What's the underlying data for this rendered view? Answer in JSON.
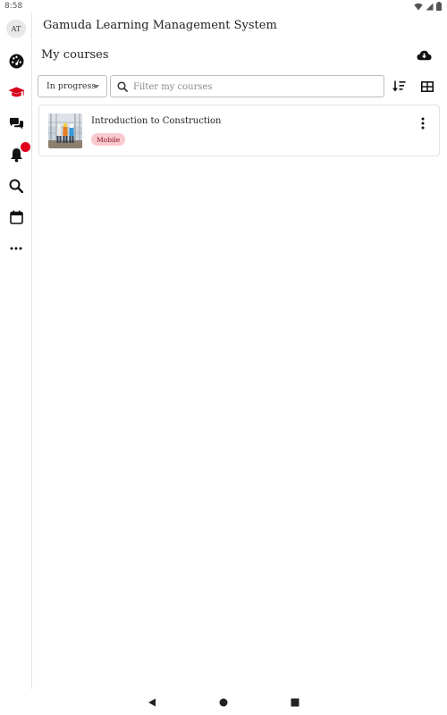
{
  "status_bar": {
    "time": "8:58",
    "icons": [
      "wifi-icon",
      "signal-icon",
      "battery-icon"
    ]
  },
  "rail": {
    "avatar_initials": "AT",
    "items": [
      {
        "name": "dashboard",
        "icon": "dashboard-gauge-icon"
      },
      {
        "name": "my-courses",
        "icon": "graduation-cap-icon",
        "active": true
      },
      {
        "name": "messages",
        "icon": "chat-bubbles-icon"
      },
      {
        "name": "notifications",
        "icon": "bell-icon",
        "badge": true
      },
      {
        "name": "search",
        "icon": "search-icon"
      },
      {
        "name": "calendar",
        "icon": "calendar-icon"
      },
      {
        "name": "more",
        "icon": "more-horizontal-icon"
      }
    ]
  },
  "header": {
    "app_title": "Gamuda Learning Management System",
    "page_title": "My courses"
  },
  "filters": {
    "status_selected": "In progress",
    "search_placeholder": "Filter my courses",
    "search_value": ""
  },
  "courses": [
    {
      "name": "Introduction to Construction",
      "tag": "Mobile"
    }
  ],
  "colors": {
    "accent": "#d7001b",
    "tag_bg": "#f8c9cd",
    "tag_text": "#8a1520",
    "badge": "#e0001b"
  }
}
